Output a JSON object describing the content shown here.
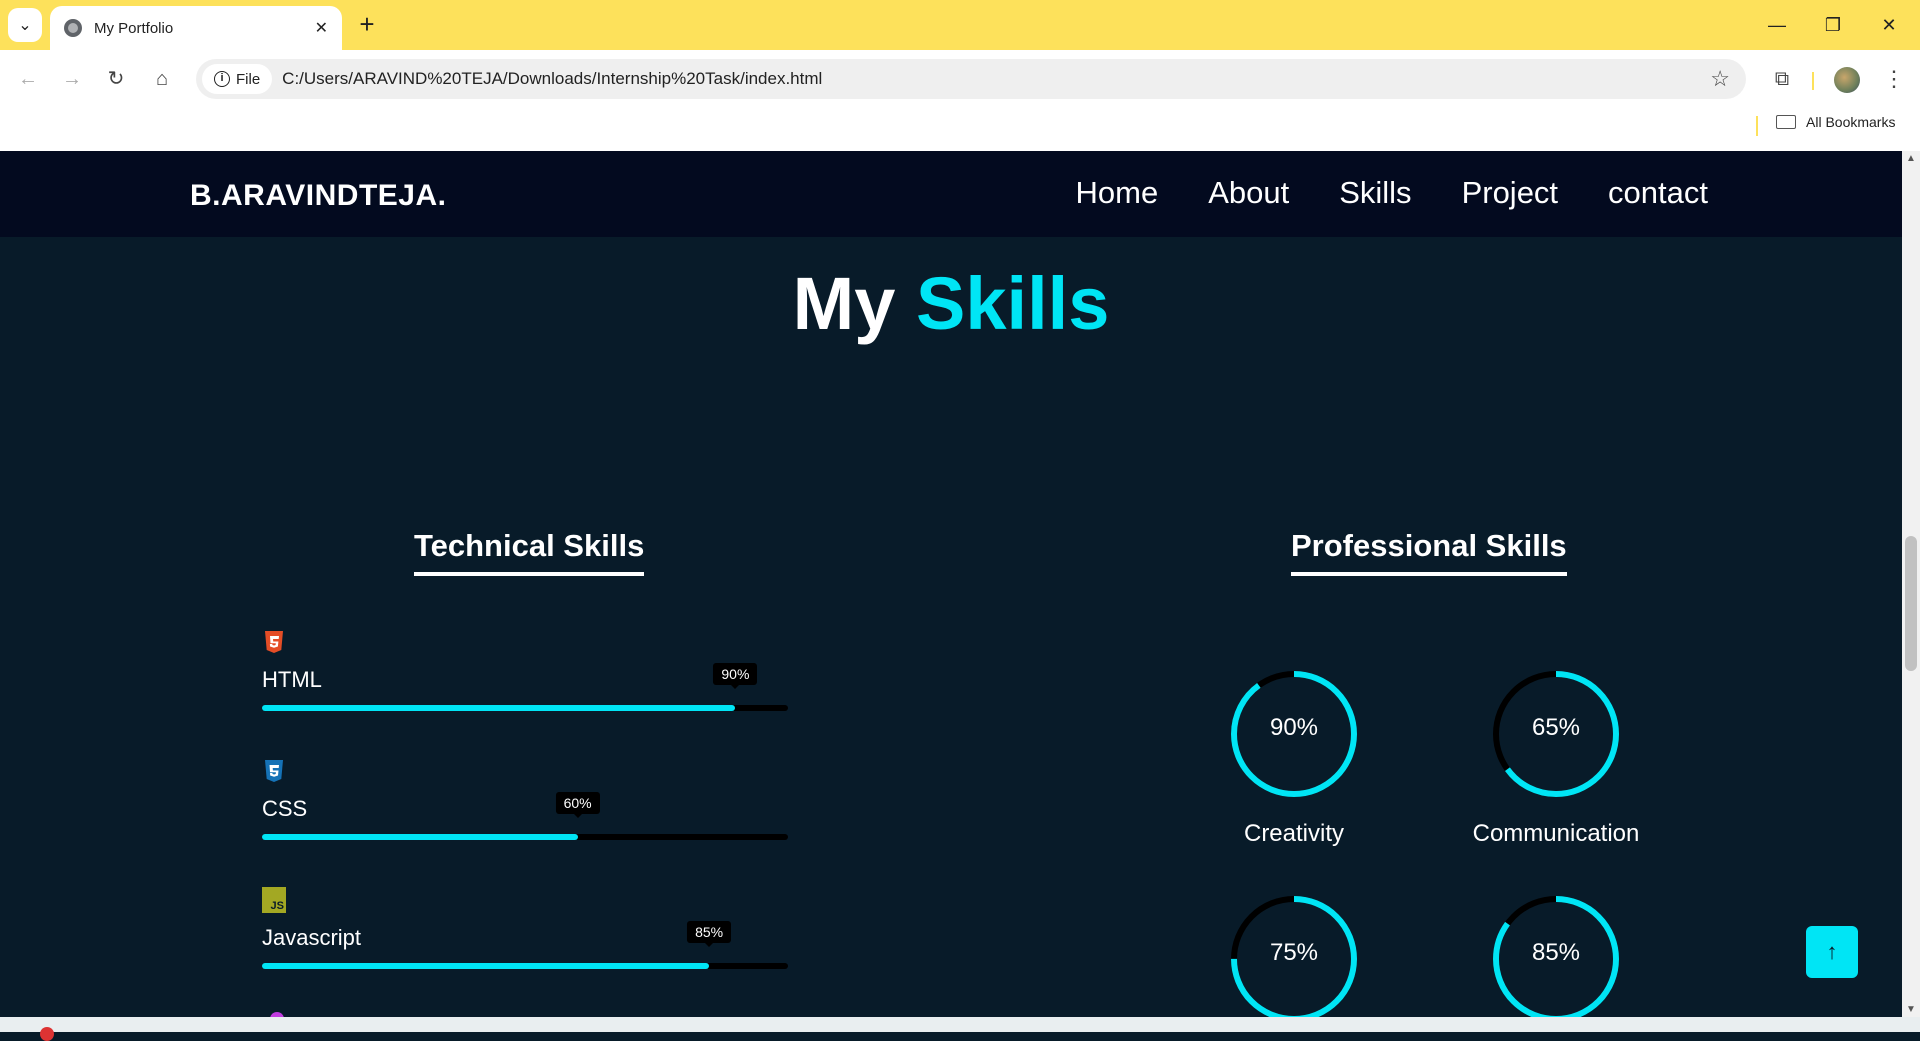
{
  "browser": {
    "tab_title": "My Portfolio",
    "site_chip_label": "File",
    "url": "C:/Users/ARAVIND%20TEJA/Downloads/Internship%20Task/index.html",
    "bookmarks_label": "All Bookmarks",
    "accent_color": "#fde15b"
  },
  "header": {
    "logo": "B.ARAVINDTEJA.",
    "nav": [
      "Home",
      "About",
      "Skills",
      "Project",
      "contact"
    ]
  },
  "skills_section": {
    "title_prefix": "My",
    "title_accent": "Skills",
    "accent_color": "#00e5f5"
  },
  "technical": {
    "title": "Technical Skills",
    "items": [
      {
        "name": "HTML",
        "percent": 90,
        "label": "90%",
        "icon": "html5-icon",
        "icon_color": "#e44d26"
      },
      {
        "name": "CSS",
        "percent": 60,
        "label": "60%",
        "icon": "css3-icon",
        "icon_color": "#1572b6"
      },
      {
        "name": "Javascript",
        "percent": 85,
        "label": "85%",
        "icon": "js-icon",
        "icon_glyph": "JS",
        "icon_color": "#a3a823"
      }
    ]
  },
  "professional": {
    "title": "Professional Skills",
    "items": [
      {
        "name": "Creativity",
        "percent": 90,
        "label": "90%"
      },
      {
        "name": "Communication",
        "percent": 65,
        "label": "65%"
      },
      {
        "name": "",
        "percent": 75,
        "label": "75%"
      },
      {
        "name": "",
        "percent": 85,
        "label": "85%"
      }
    ]
  }
}
